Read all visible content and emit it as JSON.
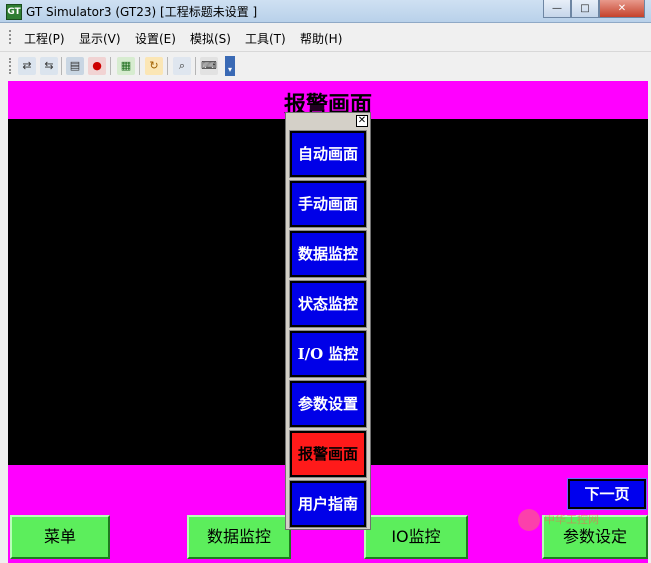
{
  "window": {
    "title": "GT Simulator3 (GT23)  [工程标题未设置 ]",
    "minimize": "—",
    "maximize": "□",
    "close": "✕"
  },
  "menu": [
    "工程(P)",
    "显示(V)",
    "设置(E)",
    "模拟(S)",
    "工具(T)",
    "帮助(H)"
  ],
  "toolbar": {
    "icons": [
      "open-icon",
      "save-icon",
      "device-icon",
      "stop-icon",
      "monitor-icon",
      "refresh-icon",
      "search-icon",
      "keyboard-icon",
      "dropdown-icon"
    ]
  },
  "hmi": {
    "title": "报警画面",
    "next_page": "下一页",
    "bottom_buttons": [
      "菜单",
      "数据监控",
      "IO监控",
      "参数设定"
    ],
    "colors": {
      "header": "#ff00ff",
      "screen": "#000000",
      "popup_button": "#0000e8",
      "active_button": "#ff1a1a",
      "footer_button": "#5cee5c"
    }
  },
  "popup": {
    "close": "✕",
    "items": [
      {
        "label": "自动画面",
        "active": false
      },
      {
        "label": "手动画面",
        "active": false
      },
      {
        "label": "数据监控",
        "active": false
      },
      {
        "label": "状态监控",
        "active": false
      },
      {
        "label": "I/O 监控",
        "active": false
      },
      {
        "label": "参数设置",
        "active": false
      },
      {
        "label": "报警画面",
        "active": true
      },
      {
        "label": "用户指南",
        "active": false
      }
    ]
  },
  "watermark": "中华工控网"
}
